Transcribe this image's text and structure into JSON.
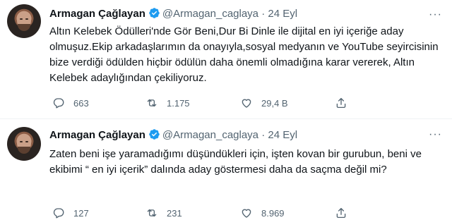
{
  "tweets": [
    {
      "author": "Armagan Çağlayan",
      "handle": "@Armagan_caglaya",
      "separator": "·",
      "date": "24 Eyl",
      "more": "···",
      "text": "Altın Kelebek Ödülleri'nde Gör Beni,Dur Bi Dinle ile dijital en iyi içeriğe aday olmuşuz.Ekip arkadaşlarımın da onayıyla,sosyal medyanın ve YouTube seyircisinin bize verdiği ödülden hiçbir ödülün daha önemli olmadığına karar vererek, Altın Kelebek adaylığından çekiliyoruz.",
      "replies": "663",
      "retweets": "1.175",
      "likes": "29,4 B"
    },
    {
      "author": "Armagan Çağlayan",
      "handle": "@Armagan_caglaya",
      "separator": "·",
      "date": "24 Eyl",
      "more": "···",
      "text": "Zaten beni işe yaramadığımı düşündükleri için, işten kovan bir gurubun, beni ve ekibimi “ en iyi içerik” dalında aday göstermesi daha da saçma değil mi?",
      "replies": "127",
      "retweets": "231",
      "likes": "8.969"
    }
  ],
  "colors": {
    "verified": "#1d9bf0",
    "secondary_text": "#536471",
    "primary_text": "#0f1419",
    "divider": "#eff3f4"
  },
  "icons": [
    "verified-badge-icon",
    "reply-icon",
    "retweet-icon",
    "like-icon",
    "share-icon",
    "more-icon"
  ]
}
